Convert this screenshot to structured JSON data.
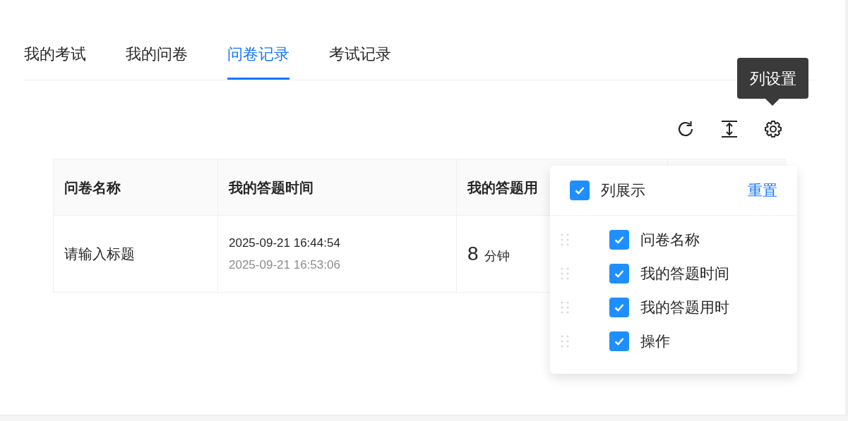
{
  "tabs": [
    {
      "label": "我的考试",
      "selected": false
    },
    {
      "label": "我的问卷",
      "selected": false
    },
    {
      "label": "问卷记录",
      "selected": true
    },
    {
      "label": "考试记录",
      "selected": false
    }
  ],
  "tooltip": {
    "text": "列设置"
  },
  "table": {
    "columns": [
      "问卷名称",
      "我的答题时间",
      "我的答题用"
    ],
    "rows": [
      {
        "name": "请输入标题",
        "start": "2025-09-21 16:44:54",
        "end": "2025-09-21 16:53:06",
        "duration": "8",
        "unit": "分钟"
      }
    ]
  },
  "column_settings": {
    "title": "列展示",
    "checked": true,
    "reset": "重置",
    "items": [
      {
        "label": "问卷名称",
        "checked": true
      },
      {
        "label": "我的答题时间",
        "checked": true
      },
      {
        "label": "我的答题用时",
        "checked": true
      },
      {
        "label": "操作",
        "checked": true
      }
    ]
  }
}
